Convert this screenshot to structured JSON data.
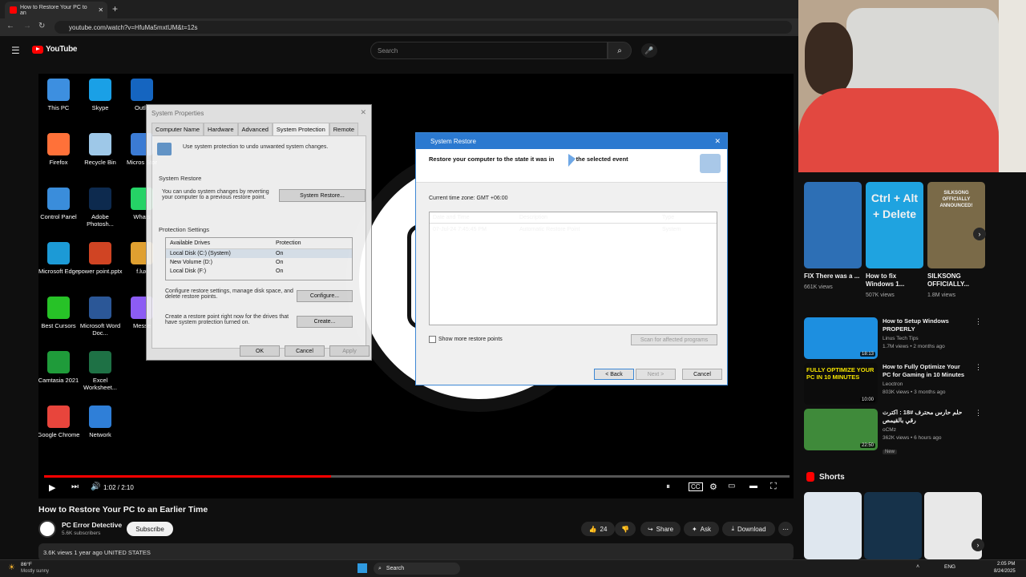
{
  "browser": {
    "tab_title": "How to Restore Your PC to an",
    "new_tab": "+",
    "url": "youtube.com/watch?v=HfuMa5mxtUM&t=12s"
  },
  "youtube": {
    "logo_text": "YouTube",
    "search_placeholder": "Search"
  },
  "video": {
    "desktop_icons": [
      {
        "label": "This PC",
        "color": "#3d8fe0"
      },
      {
        "label": "Skype",
        "color": "#1aa0e6"
      },
      {
        "label": "Outlo",
        "color": "#1565c0"
      },
      {
        "label": "Firefox",
        "color": "#ff7139"
      },
      {
        "label": "Recycle Bin",
        "color": "#9ec8e8"
      },
      {
        "label": "Micros Stor",
        "color": "#3b7bd4"
      },
      {
        "label": "Control Panel",
        "color": "#3a8ddb"
      },
      {
        "label": "Adobe Photosh...",
        "color": "#0d2a4e"
      },
      {
        "label": "Whats",
        "color": "#25d366"
      },
      {
        "label": "Microsoft Edge",
        "color": "#1c9ad6"
      },
      {
        "label": "power point.pptx",
        "color": "#d04423"
      },
      {
        "label": "f.lux",
        "color": "#e0a030"
      },
      {
        "label": "Best Cursors",
        "color": "#27c227"
      },
      {
        "label": "Microsoft Word Doc...",
        "color": "#2b5797"
      },
      {
        "label": "Messe",
        "color": "#8c5cf4"
      },
      {
        "label": "Camtasia 2021",
        "color": "#1f9b3a"
      },
      {
        "label": "Excel Worksheet...",
        "color": "#1e7145"
      },
      {
        "label": "Google Chrome",
        "color": "#e8453c"
      },
      {
        "label": "Network",
        "color": "#2f7fd8"
      }
    ],
    "sysprop": {
      "title": "System Properties",
      "tabs": [
        "Computer Name",
        "Hardware",
        "Advanced",
        "System Protection",
        "Remote"
      ],
      "intro": "Use system protection to undo unwanted system changes.",
      "restore_heading": "System Restore",
      "restore_text": "You can undo system changes by reverting your computer to a previous restore point.",
      "restore_button": "System Restore...",
      "protection_heading": "Protection Settings",
      "col_drives": "Available Drives",
      "col_protection": "Protection",
      "drives": [
        {
          "name": "Local Disk (C:) (System)",
          "protection": "On"
        },
        {
          "name": "New Volume (D:)",
          "protection": "On"
        },
        {
          "name": "Local Disk (F:)",
          "protection": "On"
        }
      ],
      "configure_text": "Configure restore settings, manage disk space, and delete restore points.",
      "configure_button": "Configure...",
      "create_text": "Create a restore point right now for the drives that have system protection turned on.",
      "create_button": "Create...",
      "ok": "OK",
      "cancel": "Cancel",
      "apply": "Apply"
    },
    "restore": {
      "title": "System Restore",
      "heading": "Restore your computer to the state it was in before the selected event",
      "heading_visible": "Restore your computer to the state it was in",
      "heading_tail": "re the selected event",
      "timezone": "Current time zone: GMT +06:00",
      "col_date": "Date and Time",
      "col_desc": "Description",
      "col_type": "Type",
      "rows": [
        {
          "date": "07-Jul-24 7:45:45 PM",
          "desc": "Automatic Restore Point",
          "type": "System"
        }
      ],
      "show_more": "Show more restore points",
      "scan": "Scan for affected programs",
      "back": "< Back",
      "next": "Next >",
      "cancel": "Cancel"
    },
    "time_display": "1:02 / 2:10",
    "progress_fraction": 0.385
  },
  "meta": {
    "title": "How to Restore Your PC to an Earlier Time",
    "channel": "PC Error Detective",
    "subscribers": "5.6K subscribers",
    "subscribe": "Subscribe",
    "likes": "24",
    "share": "Share",
    "ask": "Ask",
    "download": "Download",
    "description": "3.6K views  1 year ago  UNITED STATES"
  },
  "sidebar": {
    "cards": [
      {
        "title": "FIX There was a ...",
        "views": "661K views",
        "color": "#2d6fb5"
      },
      {
        "title": "How to fix Windows 1...",
        "views": "507K views",
        "color": "#1fa3e0",
        "overlay": "Ctrl + Alt + Delete"
      },
      {
        "title": "SILKSONG OFFICIALLY...",
        "views": "1.8M views",
        "color": "#7a6a48",
        "overlay": "SILKSONG OFFICIALLY ANNOUNCED!"
      }
    ],
    "recs": [
      {
        "title": "How to Setup Windows PROPERLY",
        "channel": "Linus Tech Tips",
        "meta": "1.7M views • 2 months ago",
        "duration": "18:13",
        "color": "#1d8fe0"
      },
      {
        "title": "How to Fully Optimize Your PC for Gaming in 10 Minutes",
        "channel": "Leoctron",
        "meta": "803K views • 3 months ago",
        "duration": "10:00",
        "color": "#0c0c0c",
        "overlay": "FULLY OPTIMIZE YOUR PC IN 10 MINUTES"
      },
      {
        "title": "حلم حارس محترف #18 : اكترت رقي بالقيمص",
        "channel": "oCMz",
        "meta": "362K views • 6 hours ago",
        "duration": "22:50",
        "badge": "New",
        "color": "#3f8a3a"
      }
    ],
    "shorts_label": "Shorts"
  },
  "taskbar": {
    "weather_temp": "86°F",
    "weather_desc": "Mostly sunny",
    "search": "Search",
    "lang": "ENG",
    "time": "2:05 PM",
    "date": "8/24/2025"
  }
}
